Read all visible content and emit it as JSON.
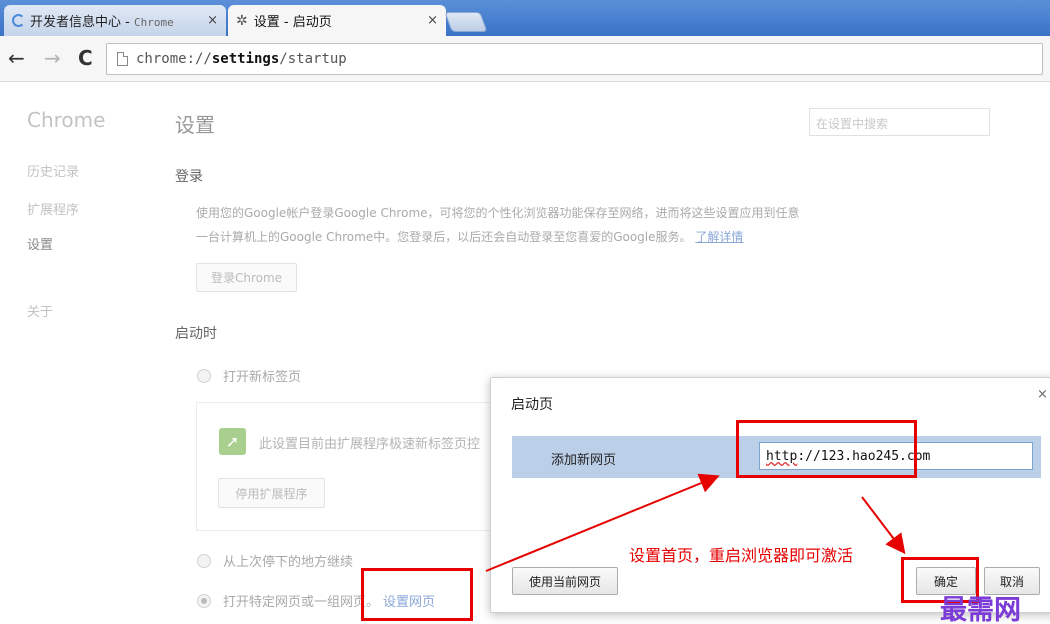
{
  "browser": {
    "tabs": [
      {
        "title": "开发者信息中心 - ",
        "title_suffix": "Chrome",
        "state": "inactive",
        "icon": "loading-spinner-icon"
      },
      {
        "title": "设置 - 启动页",
        "state": "active",
        "icon": "gear-icon"
      }
    ],
    "close_glyph": "×",
    "url_prefix": "chrome://",
    "url_host": "settings",
    "url_path": "/startup"
  },
  "sidebar": {
    "brand": "Chrome",
    "items": [
      {
        "label": "历史记录"
      },
      {
        "label": "扩展程序"
      },
      {
        "label": "设置",
        "selected": true
      },
      {
        "label": "关于"
      }
    ]
  },
  "settings": {
    "title": "设置",
    "search_placeholder": "在设置中搜索",
    "signin": {
      "heading": "登录",
      "desc_line1": "使用您的Google帐户登录Google Chrome，可将您的个性化浏览器功能保存至网络，进而将这些设置应用到任意",
      "desc_line2": "一台计算机上的Google Chrome中。您登录后，以后还会自动登录至您喜爱的Google服务。",
      "learn_more": "了解详情",
      "button": "登录Chrome"
    },
    "startup": {
      "heading": "启动时",
      "option_newtab": "打开新标签页",
      "extension_notice": "此设置目前由扩展程序极速新标签页控",
      "disable_extension": "停用扩展程序",
      "option_continue": "从上次停下的地方继续",
      "option_specific": "打开特定网页或一组网页。",
      "set_pages_link": "设置网页"
    }
  },
  "dialog": {
    "title": "启动页",
    "close_glyph": "×",
    "row_label": "添加新网页",
    "url_squiggle": "http",
    "url_rest": "://123.hao245.com",
    "use_current": "使用当前网页",
    "ok": "确定",
    "cancel": "取消"
  },
  "annotation": {
    "text": "设置首页，重启浏览器即可激活",
    "color": "#e60000"
  },
  "watermark": "最需网"
}
